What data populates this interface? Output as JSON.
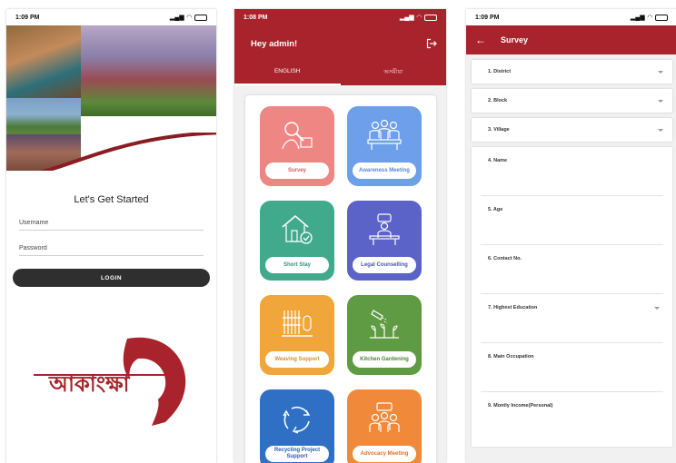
{
  "screen1": {
    "status": {
      "time": "1:09 PM"
    },
    "welcome": "Let's Get Started",
    "username_placeholder": "Username",
    "password_placeholder": "Password",
    "login_label": "LOGIN",
    "logo_text": "আকাংক্ষা",
    "colors": {
      "brand": "#a8232b",
      "button": "#2f2f2f"
    }
  },
  "screen2": {
    "status": {
      "time": "1:08 PM"
    },
    "greeting": "Hey admin!",
    "tabs": [
      {
        "label": "ENGLISH",
        "active": true
      },
      {
        "label": "অসমীয়া",
        "active": false
      }
    ],
    "tiles": [
      {
        "label": "Survey",
        "color": "#ee8683",
        "text_color": "#d0605e",
        "icon": "survey-icon"
      },
      {
        "label": "Awareness Meeting",
        "color": "#6d9fea",
        "text_color": "#5687d6",
        "icon": "awareness-meeting-icon"
      },
      {
        "label": "Short Stay",
        "color": "#41a98c",
        "text_color": "#2f957a",
        "icon": "house-icon"
      },
      {
        "label": "Legal Counselling",
        "color": "#5b63c8",
        "text_color": "#4a52b6",
        "icon": "legal-counselling-icon"
      },
      {
        "label": "Weaving Support",
        "color": "#f0a63b",
        "text_color": "#d89029",
        "icon": "weaving-icon"
      },
      {
        "label": "Kitchen Gardening",
        "color": "#5f9b42",
        "text_color": "#4b8730",
        "icon": "gardening-icon"
      },
      {
        "label": "Recycling Project Support",
        "color": "#2f6fc4",
        "text_color": "#2860b0",
        "icon": "recycle-icon"
      },
      {
        "label": "Advocacy Meeting",
        "color": "#f08a3a",
        "text_color": "#dc7428",
        "icon": "advocacy-icon"
      }
    ]
  },
  "screen3": {
    "status": {
      "time": "1:09 PM"
    },
    "title": "Survey",
    "dropdowns": [
      "1. District",
      "2. Block",
      "3. Village"
    ],
    "fields": [
      {
        "label": "4. Name",
        "dropdown": false
      },
      {
        "label": "5. Age",
        "dropdown": false
      },
      {
        "label": "6. Contact No.",
        "dropdown": false
      },
      {
        "label": "7. Highest Education",
        "dropdown": true
      },
      {
        "label": "8. Main Occupation",
        "dropdown": false
      },
      {
        "label": "9. Montly Income(Personal)",
        "dropdown": false
      }
    ]
  }
}
